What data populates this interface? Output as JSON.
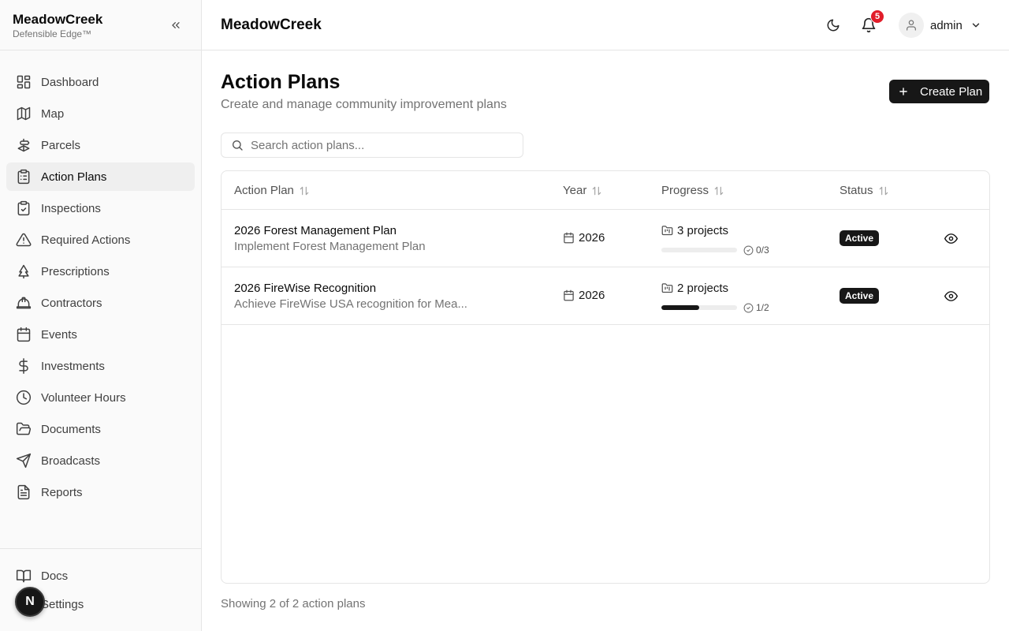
{
  "brand": {
    "name": "MeadowCreek",
    "tagline": "Defensible Edge™"
  },
  "sidebar": {
    "items": [
      {
        "label": "Dashboard",
        "icon": "dashboard-icon"
      },
      {
        "label": "Map",
        "icon": "map-icon"
      },
      {
        "label": "Parcels",
        "icon": "parcels-icon"
      },
      {
        "label": "Action Plans",
        "icon": "clipboard-list-icon",
        "active": true
      },
      {
        "label": "Inspections",
        "icon": "clipboard-check-icon"
      },
      {
        "label": "Required Actions",
        "icon": "alert-triangle-icon"
      },
      {
        "label": "Prescriptions",
        "icon": "tree-icon"
      },
      {
        "label": "Contractors",
        "icon": "hard-hat-icon"
      },
      {
        "label": "Events",
        "icon": "calendar-icon"
      },
      {
        "label": "Investments",
        "icon": "dollar-icon"
      },
      {
        "label": "Volunteer Hours",
        "icon": "clock-icon"
      },
      {
        "label": "Documents",
        "icon": "folder-open-icon"
      },
      {
        "label": "Broadcasts",
        "icon": "send-icon"
      },
      {
        "label": "Reports",
        "icon": "file-text-icon"
      }
    ],
    "bottom": [
      {
        "label": "Docs",
        "icon": "book-icon"
      },
      {
        "label": "Settings",
        "icon": "settings-icon"
      }
    ],
    "floating_avatar": "N"
  },
  "header": {
    "title": "MeadowCreek",
    "notifications_count": "5",
    "user": "admin"
  },
  "page": {
    "title": "Action Plans",
    "subtitle": "Create and manage community improvement plans",
    "create_label": "Create Plan",
    "search_placeholder": "Search action plans..."
  },
  "table": {
    "columns": [
      "Action Plan",
      "Year",
      "Progress",
      "Status"
    ],
    "rows": [
      {
        "name": "2026 Forest Management Plan",
        "description": "Implement Forest Management Plan",
        "year": "2026",
        "projects": "3 projects",
        "completed": "0/3",
        "progress": 0.0,
        "status": "Active"
      },
      {
        "name": "2026 FireWise Recognition",
        "description": "Achieve FireWise USA recognition for Mea...",
        "year": "2026",
        "projects": "2 projects",
        "completed": "1/2",
        "progress": 0.5,
        "status": "Active"
      }
    ]
  },
  "footer": {
    "count_text": "Showing 2 of 2 action plans"
  }
}
